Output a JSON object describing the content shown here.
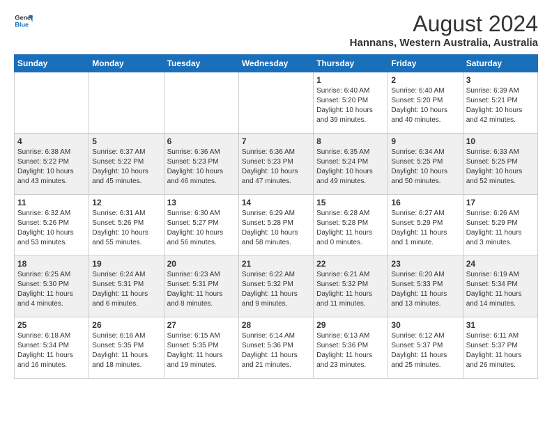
{
  "header": {
    "logo_line1": "General",
    "logo_line2": "Blue",
    "main_title": "August 2024",
    "subtitle": "Hannans, Western Australia, Australia"
  },
  "days_of_week": [
    "Sunday",
    "Monday",
    "Tuesday",
    "Wednesday",
    "Thursday",
    "Friday",
    "Saturday"
  ],
  "weeks": [
    [
      {
        "day": "",
        "content": ""
      },
      {
        "day": "",
        "content": ""
      },
      {
        "day": "",
        "content": ""
      },
      {
        "day": "",
        "content": ""
      },
      {
        "day": "1",
        "content": "Sunrise: 6:40 AM\nSunset: 5:20 PM\nDaylight: 10 hours\nand 39 minutes."
      },
      {
        "day": "2",
        "content": "Sunrise: 6:40 AM\nSunset: 5:20 PM\nDaylight: 10 hours\nand 40 minutes."
      },
      {
        "day": "3",
        "content": "Sunrise: 6:39 AM\nSunset: 5:21 PM\nDaylight: 10 hours\nand 42 minutes."
      }
    ],
    [
      {
        "day": "4",
        "content": "Sunrise: 6:38 AM\nSunset: 5:22 PM\nDaylight: 10 hours\nand 43 minutes."
      },
      {
        "day": "5",
        "content": "Sunrise: 6:37 AM\nSunset: 5:22 PM\nDaylight: 10 hours\nand 45 minutes."
      },
      {
        "day": "6",
        "content": "Sunrise: 6:36 AM\nSunset: 5:23 PM\nDaylight: 10 hours\nand 46 minutes."
      },
      {
        "day": "7",
        "content": "Sunrise: 6:36 AM\nSunset: 5:23 PM\nDaylight: 10 hours\nand 47 minutes."
      },
      {
        "day": "8",
        "content": "Sunrise: 6:35 AM\nSunset: 5:24 PM\nDaylight: 10 hours\nand 49 minutes."
      },
      {
        "day": "9",
        "content": "Sunrise: 6:34 AM\nSunset: 5:25 PM\nDaylight: 10 hours\nand 50 minutes."
      },
      {
        "day": "10",
        "content": "Sunrise: 6:33 AM\nSunset: 5:25 PM\nDaylight: 10 hours\nand 52 minutes."
      }
    ],
    [
      {
        "day": "11",
        "content": "Sunrise: 6:32 AM\nSunset: 5:26 PM\nDaylight: 10 hours\nand 53 minutes."
      },
      {
        "day": "12",
        "content": "Sunrise: 6:31 AM\nSunset: 5:26 PM\nDaylight: 10 hours\nand 55 minutes."
      },
      {
        "day": "13",
        "content": "Sunrise: 6:30 AM\nSunset: 5:27 PM\nDaylight: 10 hours\nand 56 minutes."
      },
      {
        "day": "14",
        "content": "Sunrise: 6:29 AM\nSunset: 5:28 PM\nDaylight: 10 hours\nand 58 minutes."
      },
      {
        "day": "15",
        "content": "Sunrise: 6:28 AM\nSunset: 5:28 PM\nDaylight: 11 hours\nand 0 minutes."
      },
      {
        "day": "16",
        "content": "Sunrise: 6:27 AM\nSunset: 5:29 PM\nDaylight: 11 hours\nand 1 minute."
      },
      {
        "day": "17",
        "content": "Sunrise: 6:26 AM\nSunset: 5:29 PM\nDaylight: 11 hours\nand 3 minutes."
      }
    ],
    [
      {
        "day": "18",
        "content": "Sunrise: 6:25 AM\nSunset: 5:30 PM\nDaylight: 11 hours\nand 4 minutes."
      },
      {
        "day": "19",
        "content": "Sunrise: 6:24 AM\nSunset: 5:31 PM\nDaylight: 11 hours\nand 6 minutes."
      },
      {
        "day": "20",
        "content": "Sunrise: 6:23 AM\nSunset: 5:31 PM\nDaylight: 11 hours\nand 8 minutes."
      },
      {
        "day": "21",
        "content": "Sunrise: 6:22 AM\nSunset: 5:32 PM\nDaylight: 11 hours\nand 9 minutes."
      },
      {
        "day": "22",
        "content": "Sunrise: 6:21 AM\nSunset: 5:32 PM\nDaylight: 11 hours\nand 11 minutes."
      },
      {
        "day": "23",
        "content": "Sunrise: 6:20 AM\nSunset: 5:33 PM\nDaylight: 11 hours\nand 13 minutes."
      },
      {
        "day": "24",
        "content": "Sunrise: 6:19 AM\nSunset: 5:34 PM\nDaylight: 11 hours\nand 14 minutes."
      }
    ],
    [
      {
        "day": "25",
        "content": "Sunrise: 6:18 AM\nSunset: 5:34 PM\nDaylight: 11 hours\nand 16 minutes."
      },
      {
        "day": "26",
        "content": "Sunrise: 6:16 AM\nSunset: 5:35 PM\nDaylight: 11 hours\nand 18 minutes."
      },
      {
        "day": "27",
        "content": "Sunrise: 6:15 AM\nSunset: 5:35 PM\nDaylight: 11 hours\nand 19 minutes."
      },
      {
        "day": "28",
        "content": "Sunrise: 6:14 AM\nSunset: 5:36 PM\nDaylight: 11 hours\nand 21 minutes."
      },
      {
        "day": "29",
        "content": "Sunrise: 6:13 AM\nSunset: 5:36 PM\nDaylight: 11 hours\nand 23 minutes."
      },
      {
        "day": "30",
        "content": "Sunrise: 6:12 AM\nSunset: 5:37 PM\nDaylight: 11 hours\nand 25 minutes."
      },
      {
        "day": "31",
        "content": "Sunrise: 6:11 AM\nSunset: 5:37 PM\nDaylight: 11 hours\nand 26 minutes."
      }
    ]
  ]
}
